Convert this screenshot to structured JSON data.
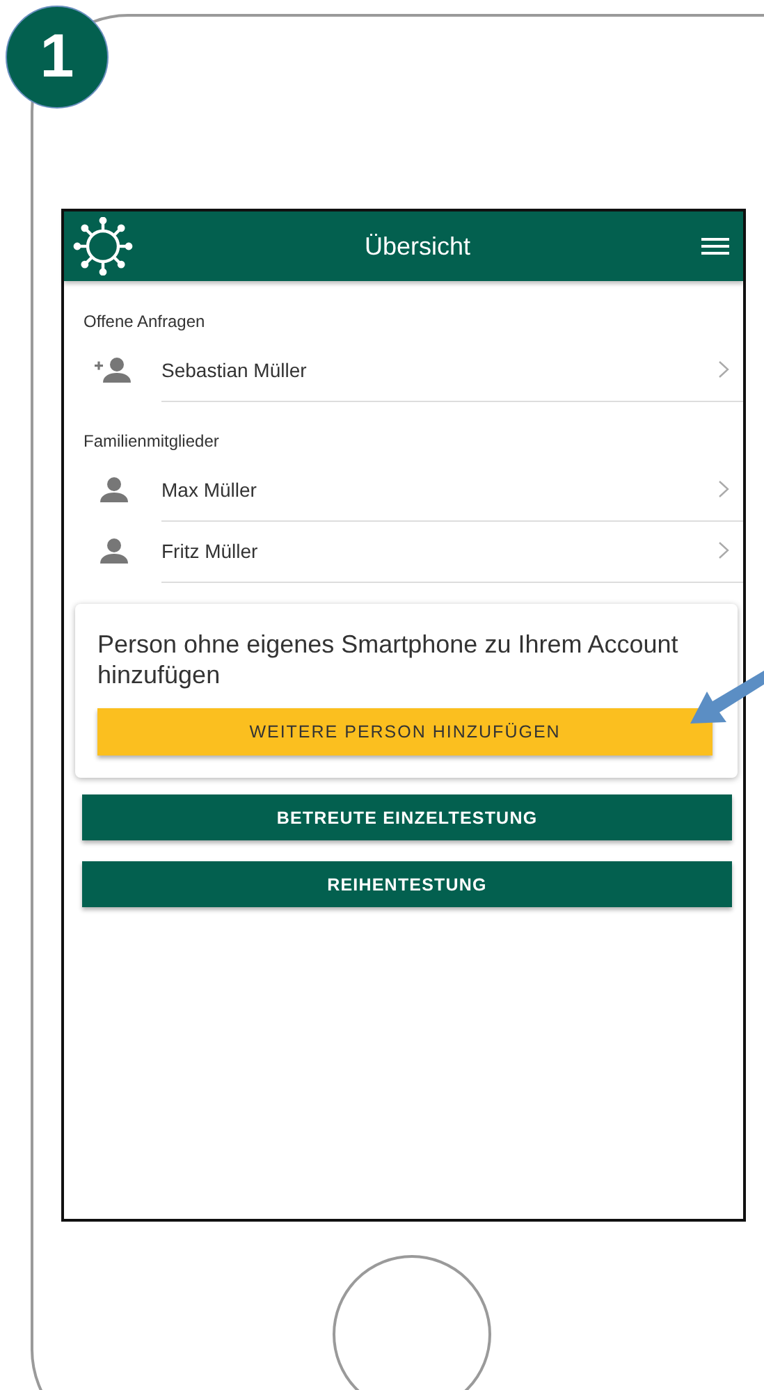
{
  "step_badge": "1",
  "header": {
    "title": "Übersicht"
  },
  "sections": [
    {
      "label": "Offene Anfragen",
      "items": [
        {
          "name": "Sebastian Müller",
          "kind": "request"
        }
      ]
    },
    {
      "label": "Familienmitglieder",
      "items": [
        {
          "name": "Max Müller",
          "kind": "member"
        },
        {
          "name": "Fritz Müller",
          "kind": "member"
        }
      ]
    }
  ],
  "add_card": {
    "text": "Person ohne eigenes Smartphone zu Ihrem Account hinzufügen",
    "button": "WEITERE PERSON HINZUFÜGEN"
  },
  "actions": [
    "BETREUTE EINZELTESTUNG",
    "REIHENTESTUNG"
  ]
}
